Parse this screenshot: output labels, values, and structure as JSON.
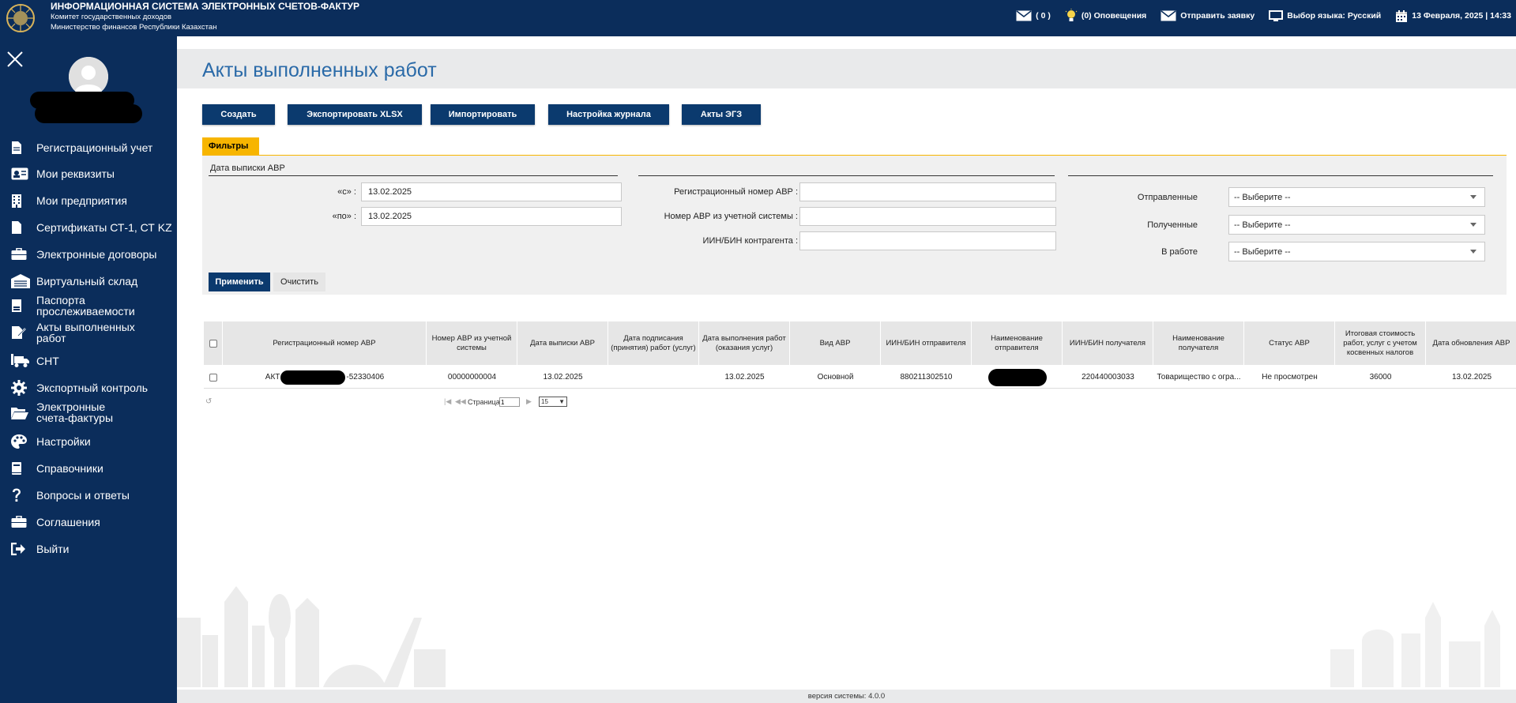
{
  "header": {
    "title_line1": "ИНФОРМАЦИОННАЯ СИСТЕМА ЭЛЕКТРОННЫХ СЧЕТОВ-ФАКТУР",
    "title_line2": "Комитет государственных доходов",
    "title_line3": "Министерство финансов Республики Казахстан",
    "messages_count": "( 0 )",
    "notifications": "(0) Оповещения",
    "send_request": "Отправить заявку",
    "language": "Выбор языка: Русский",
    "datetime": "13 Февраля, 2025 | 14:33"
  },
  "sidebar": {
    "items": [
      {
        "label": "Регистрационный учет",
        "icon": "document-icon"
      },
      {
        "label": "Мои реквизиты",
        "icon": "id-card-icon"
      },
      {
        "label": "Мои предприятия",
        "icon": "building-icon"
      },
      {
        "label": "Сертификаты СТ-1, СТ KZ",
        "icon": "file-icon"
      },
      {
        "label": "Электронные договоры",
        "icon": "briefcase-icon"
      },
      {
        "label": "Виртуальный склад",
        "icon": "warehouse-icon"
      },
      {
        "label": "Паспорта\nпрослеживаемости",
        "icon": "passport-icon"
      },
      {
        "label": "Акты выполненных\nработ",
        "icon": "act-icon"
      },
      {
        "label": "СНТ",
        "icon": "truck-icon"
      },
      {
        "label": "Экспортный контроль",
        "icon": "cog-icon"
      },
      {
        "label": "Электронные\nсчета-фактуры",
        "icon": "folder-icon"
      },
      {
        "label": "Настройки",
        "icon": "palette-icon"
      },
      {
        "label": "Справочники",
        "icon": "book-icon"
      },
      {
        "label": "Вопросы и ответы",
        "icon": "question-icon"
      },
      {
        "label": "Соглашения",
        "icon": "briefcase-icon"
      },
      {
        "label": "Выйти",
        "icon": "logout-icon"
      }
    ]
  },
  "page": {
    "title": "Акты выполненных работ",
    "buttons": {
      "create": "Создать",
      "export": "Экспортировать XLSX",
      "import": "Импортировать",
      "journal_settings": "Настройка журнала",
      "egz": "Акты ЭГЗ"
    },
    "filters_tab": "Фильтры",
    "filters": {
      "date_group": "Дата выписки АВР",
      "from_label": "«с» :",
      "from_value": "13.02.2025",
      "to_label": "«по» :",
      "to_value": "13.02.2025",
      "reg_num_label": "Регистрационный номер АВР :",
      "acc_num_label": "Номер АВР из учетной системы :",
      "iin_label": "ИИН/БИН контрагента :",
      "sent_label": "Отправленные",
      "received_label": "Полученные",
      "in_work_label": "В работе",
      "select_placeholder": "-- Выберите --"
    },
    "apply": "Применить",
    "clear": "Очистить"
  },
  "table": {
    "columns": [
      "Регистрационный номер АВР",
      "Номер АВР из учетной системы",
      "Дата выписки АВР",
      "Дата подписания (принятия) работ (услуг)",
      "Дата выполнения работ (оказания услуг)",
      "Вид АВР",
      "ИИН/БИН отправителя",
      "Наименование отправителя",
      "ИИН/БИН получателя",
      "Наименование получателя",
      "Статус АВР",
      "Итоговая стоимость работ, услуг с учетом косвенных налогов",
      "Дата обновления АВР"
    ],
    "rows": [
      {
        "reg_prefix": "АКТ",
        "reg_suffix": "-52330406",
        "acc_num": "00000000004",
        "issue_date": "13.02.2025",
        "sign_date": "",
        "perform_date": "13.02.2025",
        "kind": "Основной",
        "sender_iin": "880211302510",
        "sender_name": "",
        "receiver_iin": "220440003033",
        "receiver_name": "Товарищество с огра...",
        "status": "Не просмотрен",
        "total": "36000",
        "update_date": "13.02.2025"
      }
    ],
    "pager": {
      "page_label": "Страница",
      "page_value": "1",
      "page_size": "15"
    }
  },
  "footer": {
    "version": "версия системы: 4.0.0"
  },
  "colors": {
    "nav_bg": "#0b2d5b",
    "button_bg": "#0b3a6e",
    "accent": "#f7b500",
    "title": "#2a6aa8"
  }
}
